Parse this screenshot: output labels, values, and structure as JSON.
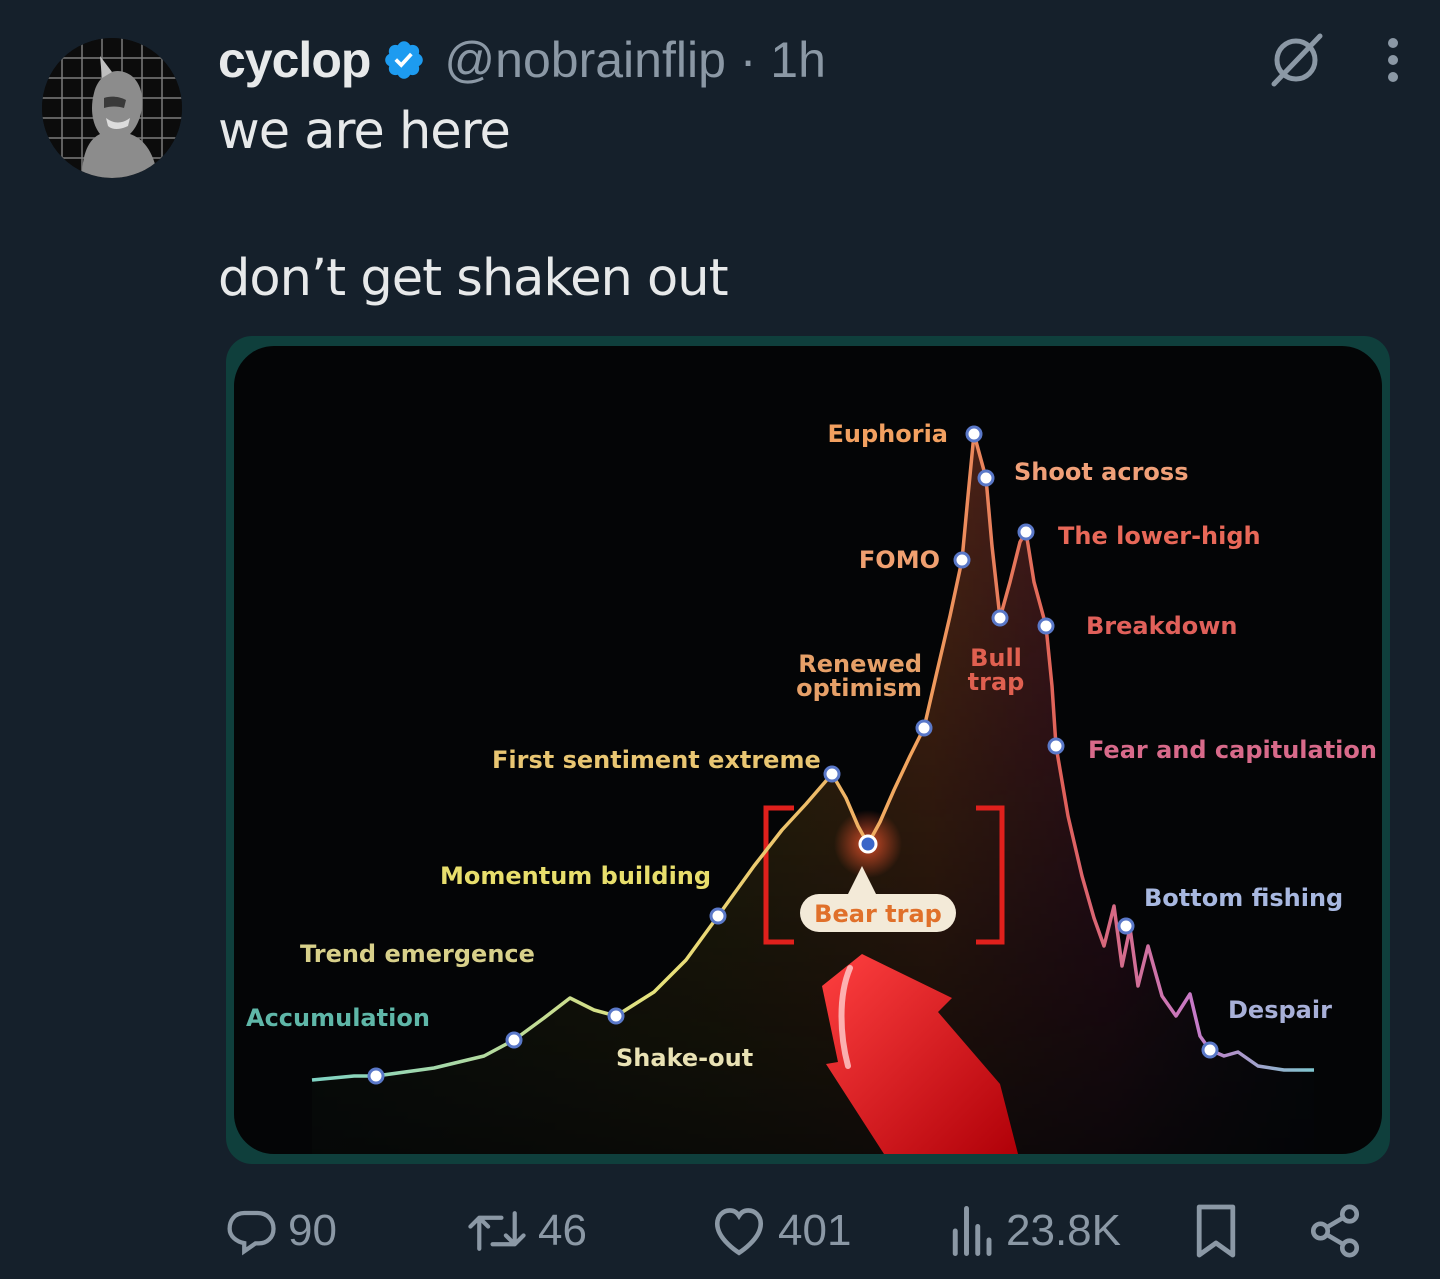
{
  "tweet": {
    "author_name": "cyclop",
    "handle_time": "@nobrainflip · 1h",
    "text_line1": "we are here",
    "text_line2": "don’t get shaken out"
  },
  "icons": {
    "verified": "verified-badge-icon",
    "grok": "grok-slash-icon",
    "more": "more-vertical-icon",
    "reply": "reply-icon",
    "retweet": "retweet-icon",
    "like": "heart-icon",
    "views": "views-bar-icon",
    "bookmark": "bookmark-icon",
    "share": "share-icon"
  },
  "actions": {
    "replies": "90",
    "retweets": "46",
    "likes": "401",
    "views": "23.8K"
  },
  "colors": {
    "background": "#15202b",
    "accent_blue": "#1d9bf0",
    "muted_text": "#8b98a5"
  },
  "chart_data": {
    "type": "line",
    "points": [
      {
        "label": "Accumulation"
      },
      {
        "label": "Trend emergence"
      },
      {
        "label": "Shake-out"
      },
      {
        "label": "Momentum building"
      },
      {
        "label": "First sentiment extreme"
      },
      {
        "label": "Bear trap"
      },
      {
        "label": "Renewed optimism"
      },
      {
        "label": "FOMO"
      },
      {
        "label": "Euphoria"
      },
      {
        "label": "Shoot across"
      },
      {
        "label": "Bull trap"
      },
      {
        "label": "The lower-high"
      },
      {
        "label": "Breakdown"
      },
      {
        "label": "Fear and capitulation"
      },
      {
        "label": "Bottom fishing"
      },
      {
        "label": "Despair"
      }
    ]
  }
}
